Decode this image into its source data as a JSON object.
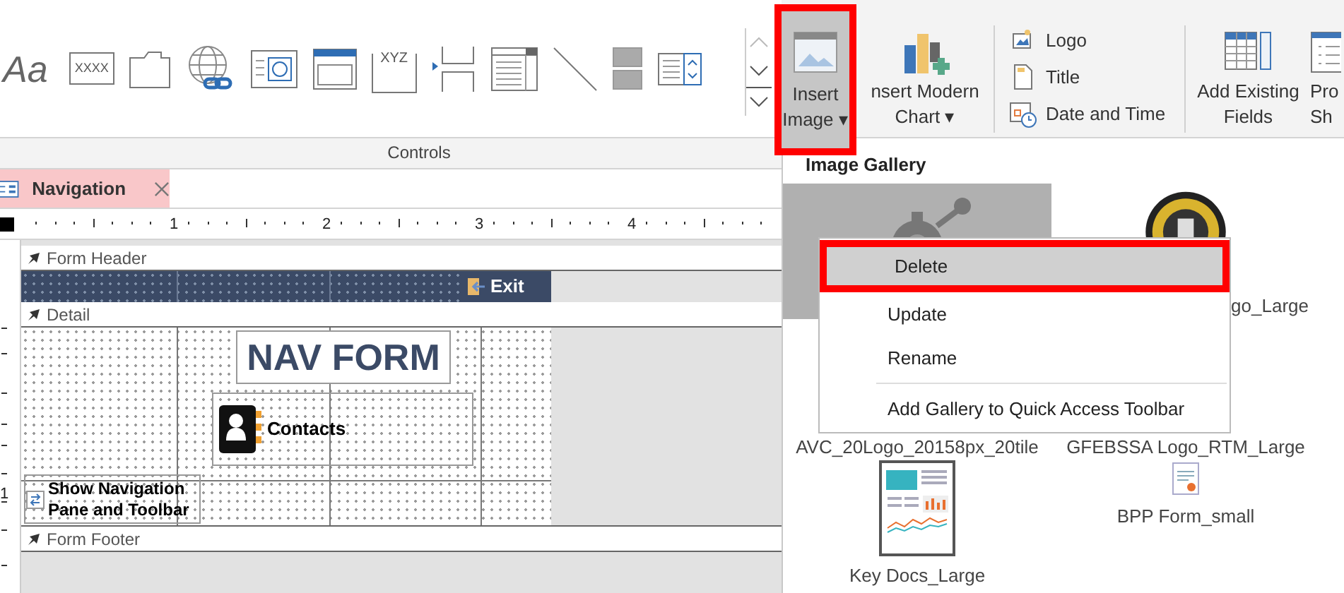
{
  "ribbon": {
    "tools": [
      {
        "kind": "label",
        "glyph": "Aa"
      },
      {
        "kind": "textbox",
        "glyph": "XXXX"
      },
      {
        "kind": "tab"
      },
      {
        "kind": "hyperlink"
      },
      {
        "kind": "web"
      },
      {
        "kind": "navigation"
      },
      {
        "kind": "frame",
        "glyph": "XYZ"
      },
      {
        "kind": "pagebreak"
      },
      {
        "kind": "listbox"
      },
      {
        "kind": "line"
      },
      {
        "kind": "toggle"
      },
      {
        "kind": "combo"
      }
    ],
    "group_label": "Controls",
    "insert_image": {
      "lines": [
        "Insert",
        "Image ▾"
      ],
      "selected": true,
      "highlighted": true
    },
    "insert_chart": {
      "lines": [
        "nsert Modern",
        "Chart ▾"
      ]
    },
    "small_buttons": [
      {
        "kind": "logo",
        "label": "Logo"
      },
      {
        "kind": "title",
        "label": "Title"
      },
      {
        "kind": "datetime",
        "label": "Date and Time"
      }
    ],
    "add_fields": {
      "lines": [
        "Add Existing",
        "Fields"
      ]
    },
    "property_sheet": {
      "lines": [
        "Pro",
        "Sh"
      ]
    }
  },
  "document_tab": {
    "label": "Navigation",
    "selected": true
  },
  "ruler": {
    "marks": [
      "1",
      "2",
      "3",
      "4"
    ],
    "vertical_mark": "1"
  },
  "form": {
    "sections": [
      {
        "kind": "header",
        "label": "Form Header"
      },
      {
        "kind": "detail",
        "label": "Detail"
      },
      {
        "kind": "footer",
        "label": "Form Footer"
      }
    ],
    "exit_button": "Exit",
    "title": "NAV FORM",
    "contacts_button": "Contacts",
    "nav_toggle": [
      "Show Navigation",
      "Pane and Toolbar"
    ]
  },
  "gallery": {
    "title": "Image Gallery",
    "items": [
      {
        "kind": "gear",
        "selected": true
      },
      {
        "kind": "seal",
        "label": "go_Large",
        "selected": false
      },
      {
        "kind": "hidden",
        "label": "AVC_20Logo_20158px_20tile",
        "selected": false
      },
      {
        "kind": "hidden",
        "label": "GFEBSSA Logo_RTM_Large",
        "selected": false
      },
      {
        "kind": "report",
        "label": "Key Docs_Large",
        "selected": false
      },
      {
        "kind": "form",
        "label": "BPP Form_small",
        "selected": false
      }
    ]
  },
  "context_menu": [
    {
      "kind": "item",
      "label": "Delete",
      "selected": true,
      "highlighted": true
    },
    {
      "kind": "item",
      "label": "Update",
      "selected": false,
      "highlighted": false
    },
    {
      "kind": "item",
      "label": "Rename",
      "selected": false,
      "highlighted": false
    },
    {
      "kind": "separator"
    },
    {
      "kind": "item",
      "label": "Add Gallery to Quick Access Toolbar",
      "selected": false,
      "highlighted": false
    }
  ]
}
